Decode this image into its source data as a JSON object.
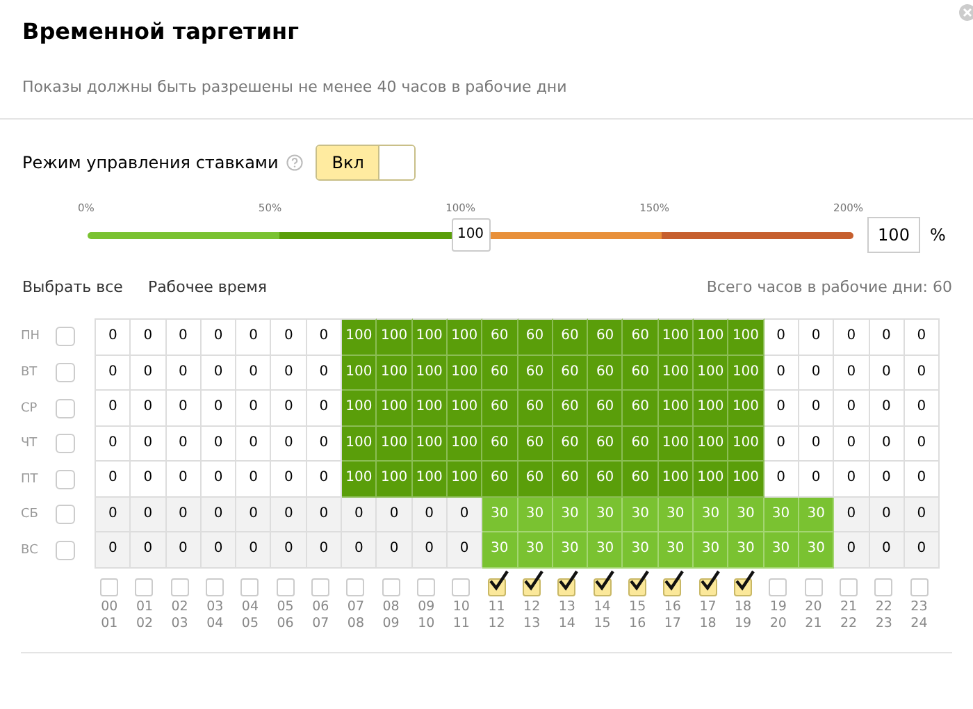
{
  "title": "Временной таргетинг",
  "subtitle": "Показы должны быть разрешены не менее 40 часов в рабочие дни",
  "bid_mode": {
    "label": "Режим управления ставками",
    "toggle_label": "Вкл",
    "on": true
  },
  "slider": {
    "ticks": [
      "0%",
      "50%",
      "100%",
      "150%",
      "200%"
    ],
    "level": 0.5,
    "thumb": "100",
    "value": "100",
    "unit": "%"
  },
  "links": [
    "Выбрать все",
    "Рабочее время"
  ],
  "total": "Всего часов в рабочие дни: 60",
  "rows": [
    {
      "day": "ПН",
      "checked": false,
      "weekend": false,
      "cells": [
        "0",
        "0",
        "0",
        "0",
        "0",
        "0",
        "0",
        "100",
        "100",
        "100",
        "100",
        "60",
        "60",
        "60",
        "60",
        "60",
        "100",
        "100",
        "100",
        "0",
        "0",
        "0",
        "0",
        "0"
      ]
    },
    {
      "day": "ВТ",
      "checked": false,
      "weekend": false,
      "cells": [
        "0",
        "0",
        "0",
        "0",
        "0",
        "0",
        "0",
        "100",
        "100",
        "100",
        "100",
        "60",
        "60",
        "60",
        "60",
        "60",
        "100",
        "100",
        "100",
        "0",
        "0",
        "0",
        "0",
        "0"
      ]
    },
    {
      "day": "СР",
      "checked": false,
      "weekend": false,
      "cells": [
        "0",
        "0",
        "0",
        "0",
        "0",
        "0",
        "0",
        "100",
        "100",
        "100",
        "100",
        "60",
        "60",
        "60",
        "60",
        "60",
        "100",
        "100",
        "100",
        "0",
        "0",
        "0",
        "0",
        "0"
      ]
    },
    {
      "day": "ЧТ",
      "checked": false,
      "weekend": false,
      "cells": [
        "0",
        "0",
        "0",
        "0",
        "0",
        "0",
        "0",
        "100",
        "100",
        "100",
        "100",
        "60",
        "60",
        "60",
        "60",
        "60",
        "100",
        "100",
        "100",
        "0",
        "0",
        "0",
        "0",
        "0"
      ]
    },
    {
      "day": "ПТ",
      "checked": false,
      "weekend": false,
      "cells": [
        "0",
        "0",
        "0",
        "0",
        "0",
        "0",
        "0",
        "100",
        "100",
        "100",
        "100",
        "60",
        "60",
        "60",
        "60",
        "60",
        "100",
        "100",
        "100",
        "0",
        "0",
        "0",
        "0",
        "0"
      ]
    },
    {
      "day": "СБ",
      "checked": false,
      "weekend": true,
      "cells": [
        "0",
        "0",
        "0",
        "0",
        "0",
        "0",
        "0",
        "0",
        "0",
        "0",
        "0",
        "30",
        "30",
        "30",
        "30",
        "30",
        "30",
        "30",
        "30",
        "30",
        "30",
        "0",
        "0",
        "0"
      ]
    },
    {
      "day": "ВС",
      "checked": false,
      "weekend": true,
      "cells": [
        "0",
        "0",
        "0",
        "0",
        "0",
        "0",
        "0",
        "0",
        "0",
        "0",
        "0",
        "30",
        "30",
        "30",
        "30",
        "30",
        "30",
        "30",
        "30",
        "30",
        "30",
        "0",
        "0",
        "0"
      ]
    }
  ],
  "hours": [
    {
      "from": "00",
      "to": "01",
      "checked": false
    },
    {
      "from": "01",
      "to": "02",
      "checked": false
    },
    {
      "from": "02",
      "to": "03",
      "checked": false
    },
    {
      "from": "03",
      "to": "04",
      "checked": false
    },
    {
      "from": "04",
      "to": "05",
      "checked": false
    },
    {
      "from": "05",
      "to": "06",
      "checked": false
    },
    {
      "from": "06",
      "to": "07",
      "checked": false
    },
    {
      "from": "07",
      "to": "08",
      "checked": false
    },
    {
      "from": "08",
      "to": "09",
      "checked": false
    },
    {
      "from": "09",
      "to": "10",
      "checked": false
    },
    {
      "from": "10",
      "to": "11",
      "checked": false
    },
    {
      "from": "11",
      "to": "12",
      "checked": true
    },
    {
      "from": "12",
      "to": "13",
      "checked": true
    },
    {
      "from": "13",
      "to": "14",
      "checked": true
    },
    {
      "from": "14",
      "to": "15",
      "checked": true
    },
    {
      "from": "15",
      "to": "16",
      "checked": true
    },
    {
      "from": "16",
      "to": "17",
      "checked": true
    },
    {
      "from": "17",
      "to": "18",
      "checked": true
    },
    {
      "from": "18",
      "to": "19",
      "checked": true
    },
    {
      "from": "19",
      "to": "20",
      "checked": false
    },
    {
      "from": "20",
      "to": "21",
      "checked": false
    },
    {
      "from": "21",
      "to": "22",
      "checked": false
    },
    {
      "from": "22",
      "to": "23",
      "checked": false
    },
    {
      "from": "23",
      "to": "24",
      "checked": false
    }
  ]
}
